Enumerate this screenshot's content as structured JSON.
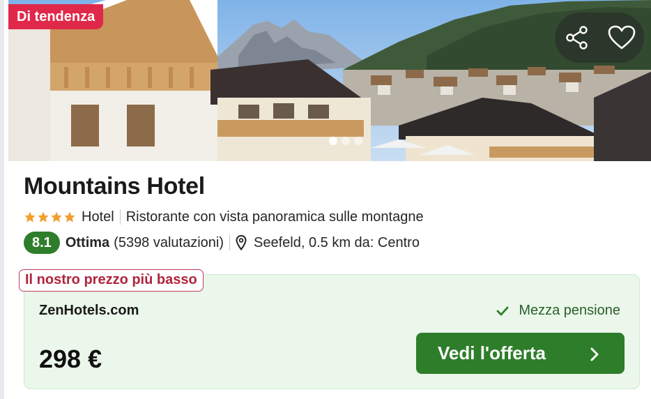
{
  "badge": {
    "label": "Di tendenza"
  },
  "hotel": {
    "name": "Mountains Hotel",
    "stars": 4,
    "type": "Hotel",
    "feature": "Ristorante con vista panoramica sulle montagne",
    "score": "8.1",
    "rating_word": "Ottima",
    "reviews": "(5398 valutazioni)",
    "location": "Seefeld, 0.5 km da: Centro"
  },
  "gallery": {
    "total_dots": 3,
    "active_dot": 1
  },
  "offer": {
    "tag": "Il nostro prezzo più basso",
    "provider": "ZenHotels.com",
    "board": "Mezza pensione",
    "price": "298 €",
    "cta": "Vedi l'offerta"
  },
  "icons": {
    "share": "share-icon",
    "favorite": "heart-icon",
    "star": "star-icon",
    "location": "map-pin-icon",
    "check": "check-icon",
    "chevron": "chevron-right-icon"
  },
  "colors": {
    "badge": "#e0294a",
    "score": "#2e7d2a",
    "cta": "#2e7d2a",
    "offer_bg": "#eaf7ea",
    "lowest_tag": "#b0243e",
    "star": "#f0a030"
  }
}
